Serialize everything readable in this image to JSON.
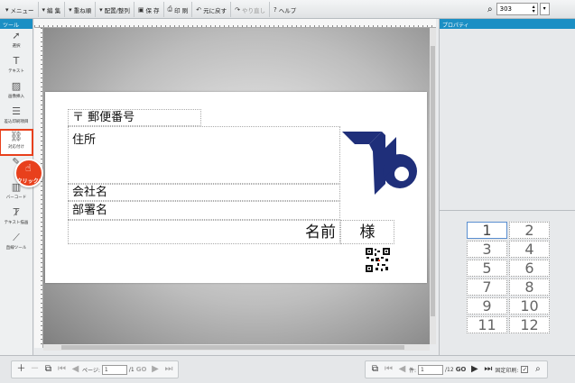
{
  "toolbar": {
    "menu": "メニュー",
    "edit": "編 集",
    "layers": "重ね順",
    "align": "配置/整列",
    "save": "保 存",
    "print": "印 刷",
    "undo": "元に戻す",
    "redo": "やり直し",
    "help": "ヘルプ",
    "zoom_value": "303"
  },
  "tools": {
    "header": "ツール",
    "items": [
      "選択",
      "テキスト",
      "画像挿入",
      "差込印刷項目",
      "対応付け",
      "テ",
      "図形",
      "バーコード",
      "テキスト描画",
      "直線ツール"
    ],
    "click_label": "クリック!"
  },
  "properties": {
    "header": "プロパティ"
  },
  "card": {
    "postal": "〒 郵便番号",
    "address": "住所",
    "company": "会社名",
    "department": "部署名",
    "name": "名前",
    "honorific": "様"
  },
  "layout_grid": [
    "1",
    "2",
    "3",
    "4",
    "5",
    "6",
    "7",
    "8",
    "9",
    "10",
    "11",
    "12"
  ],
  "bottom": {
    "page_label": "ページ:",
    "page_value": "1",
    "page_total": "/1",
    "go": "GO",
    "record_label": "件:",
    "record_value": "1",
    "record_total": "/12",
    "fixed_print": "固定印刷:"
  },
  "colors": {
    "accent": "#1b8fc4",
    "highlight": "#e8401c",
    "logo": "#1f2f7a"
  }
}
